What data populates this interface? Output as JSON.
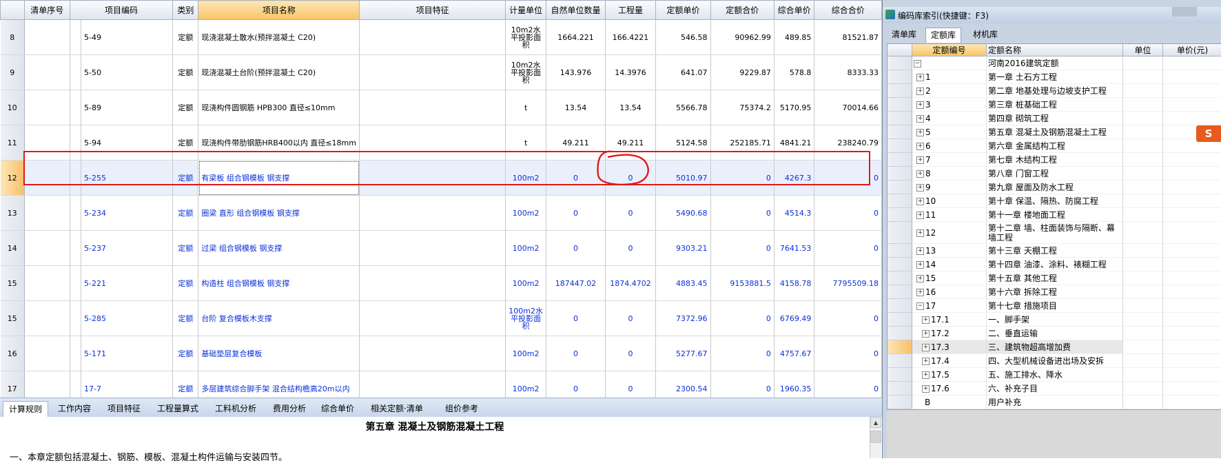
{
  "grid": {
    "headers": [
      "清单序号",
      "项目编码",
      "类别",
      "项目名称",
      "项目特征",
      "计量单位",
      "自然单位数量",
      "工程量",
      "定额单价",
      "定额合价",
      "综合单价",
      "综合合价"
    ],
    "rows": [
      {
        "rn": "8",
        "code": "5-49",
        "type": "定额",
        "name": "现浇混凝土散水(预拌混凝土 C20)",
        "unit": "10m2水平投影面积",
        "nat": "1664.221",
        "qty": "166.4221",
        "uprice": "546.58",
        "total": "90962.99",
        "cprice": "489.85",
        "ctotal": "81521.87"
      },
      {
        "rn": "9",
        "code": "5-50",
        "type": "定额",
        "name": "现浇混凝土台阶(预拌混凝土 C20)",
        "unit": "10m2水平投影面积",
        "nat": "143.976",
        "qty": "14.3976",
        "uprice": "641.07",
        "total": "9229.87",
        "cprice": "578.8",
        "ctotal": "8333.33"
      },
      {
        "rn": "10",
        "code": "5-89",
        "type": "定额",
        "name": "现浇构件圆钢筋  HPB300 直径≤10mm",
        "unit": "t",
        "nat": "13.54",
        "qty": "13.54",
        "uprice": "5566.78",
        "total": "75374.2",
        "cprice": "5170.95",
        "ctotal": "70014.66"
      },
      {
        "rn": "11",
        "code": "5-94",
        "type": "定额",
        "name": "现浇构件带肋钢筋HRB400以内 直径≤18mm",
        "unit": "t",
        "nat": "49.211",
        "qty": "49.211",
        "uprice": "5124.58",
        "total": "252185.71",
        "cprice": "4841.21",
        "ctotal": "238240.79"
      },
      {
        "rn": "12",
        "code": "5-255",
        "type": "定额",
        "name": "有梁板 组合钢模板 钢支撑",
        "unit": "100m2",
        "nat": "0",
        "qty": "0",
        "uprice": "5010.97",
        "total": "0",
        "cprice": "4267.3",
        "ctotal": "0"
      },
      {
        "rn": "13",
        "code": "5-234",
        "type": "定额",
        "name": "圈梁 直形 组合钢模板 钢支撑",
        "unit": "100m2",
        "nat": "0",
        "qty": "0",
        "uprice": "5490.68",
        "total": "0",
        "cprice": "4514.3",
        "ctotal": "0"
      },
      {
        "rn": "14",
        "code": "5-237",
        "type": "定额",
        "name": "过梁 组合钢模板 钢支撑",
        "unit": "100m2",
        "nat": "0",
        "qty": "0",
        "uprice": "9303.21",
        "total": "0",
        "cprice": "7641.53",
        "ctotal": "0"
      },
      {
        "rn": "15",
        "code": "5-221",
        "type": "定额",
        "name": "构造柱 组合钢模板 钢支撑",
        "unit": "100m2",
        "nat": "187447.02",
        "qty": "1874.4702",
        "uprice": "4883.45",
        "total": "9153881.5",
        "cprice": "4158.78",
        "ctotal": "7795509.18"
      },
      {
        "rn": "15",
        "code": "5-285",
        "type": "定额",
        "name": "台阶 复合模板木支撑",
        "unit": "100m2水平投影面积",
        "nat": "0",
        "qty": "0",
        "uprice": "7372.96",
        "total": "0",
        "cprice": "6769.49",
        "ctotal": "0"
      },
      {
        "rn": "16",
        "code": "5-171",
        "type": "定额",
        "name": "基础垫层复合模板",
        "unit": "100m2",
        "nat": "0",
        "qty": "0",
        "uprice": "5277.67",
        "total": "0",
        "cprice": "4757.67",
        "ctotal": "0"
      },
      {
        "rn": "17",
        "code": "17-7",
        "type": "定额",
        "name": "多层建筑综合脚手架  混合结构檐高20m以内",
        "unit": "100m2",
        "nat": "0",
        "qty": "0",
        "uprice": "2300.54",
        "total": "0",
        "cprice": "1960.35",
        "ctotal": "0"
      }
    ]
  },
  "bottom": {
    "tabs": [
      "计算规则",
      "工作内容",
      "项目特征",
      "工程量算式",
      "工料机分析",
      "费用分析",
      "综合单价",
      "相关定额·清单",
      "组价参考"
    ],
    "title": "第五章  混凝土及钢筋混凝土工程",
    "line": "一、本章定额包括混凝土、钢筋、模板、混凝土构件运输与安装四节。"
  },
  "panel": {
    "title": "编码库索引(快捷键：F3)",
    "tabs": [
      "清单库",
      "定额库",
      "材机库"
    ],
    "headers": [
      "定额编号",
      "定额名称",
      "单位",
      "单价(元)"
    ],
    "rows": [
      {
        "code": "",
        "name": "河南2016建筑定额",
        "exp": "−"
      },
      {
        "code": "1",
        "name": "第一章 土石方工程",
        "exp": "+"
      },
      {
        "code": "2",
        "name": "第二章 地基处理与边坡支护工程",
        "exp": "+"
      },
      {
        "code": "3",
        "name": "第三章 桩基础工程",
        "exp": "+"
      },
      {
        "code": "4",
        "name": "第四章 砌筑工程",
        "exp": "+"
      },
      {
        "code": "5",
        "name": "第五章 混凝土及钢筋混凝土工程",
        "exp": "+"
      },
      {
        "code": "6",
        "name": "第六章 金属结构工程",
        "exp": "+"
      },
      {
        "code": "7",
        "name": "第七章 木结构工程",
        "exp": "+"
      },
      {
        "code": "8",
        "name": "第八章 门窗工程",
        "exp": "+"
      },
      {
        "code": "9",
        "name": "第九章 屋面及防水工程",
        "exp": "+"
      },
      {
        "code": "10",
        "name": "第十章 保温、隔热、防腐工程",
        "exp": "+"
      },
      {
        "code": "11",
        "name": "第十一章 楼地面工程",
        "exp": "+"
      },
      {
        "code": "12",
        "name": "第十二章 墙、柱面装饰与隔断、幕墙工程",
        "exp": "+"
      },
      {
        "code": "13",
        "name": "第十三章 天棚工程",
        "exp": "+"
      },
      {
        "code": "14",
        "name": "第十四章 油漆、涂料、裱糊工程",
        "exp": "+"
      },
      {
        "code": "15",
        "name": "第十五章 其他工程",
        "exp": "+"
      },
      {
        "code": "16",
        "name": "第十六章 拆除工程",
        "exp": "+"
      },
      {
        "code": "17",
        "name": "第十七章 措施项目",
        "exp": "−"
      },
      {
        "code": "17.1",
        "name": "一、脚手架",
        "exp": "+"
      },
      {
        "code": "17.2",
        "name": "二、垂直运输",
        "exp": "+"
      },
      {
        "code": "17.3",
        "name": "三、建筑物超高增加费",
        "exp": "+"
      },
      {
        "code": "17.4",
        "name": "四、大型机械设备进出场及安拆",
        "exp": "+"
      },
      {
        "code": "17.5",
        "name": "五、施工排水、降水",
        "exp": "+"
      },
      {
        "code": "17.6",
        "name": "六、补充子目",
        "exp": "+"
      },
      {
        "code": "B",
        "name": "用户补充",
        "exp": ""
      }
    ]
  },
  "sogou": "S"
}
